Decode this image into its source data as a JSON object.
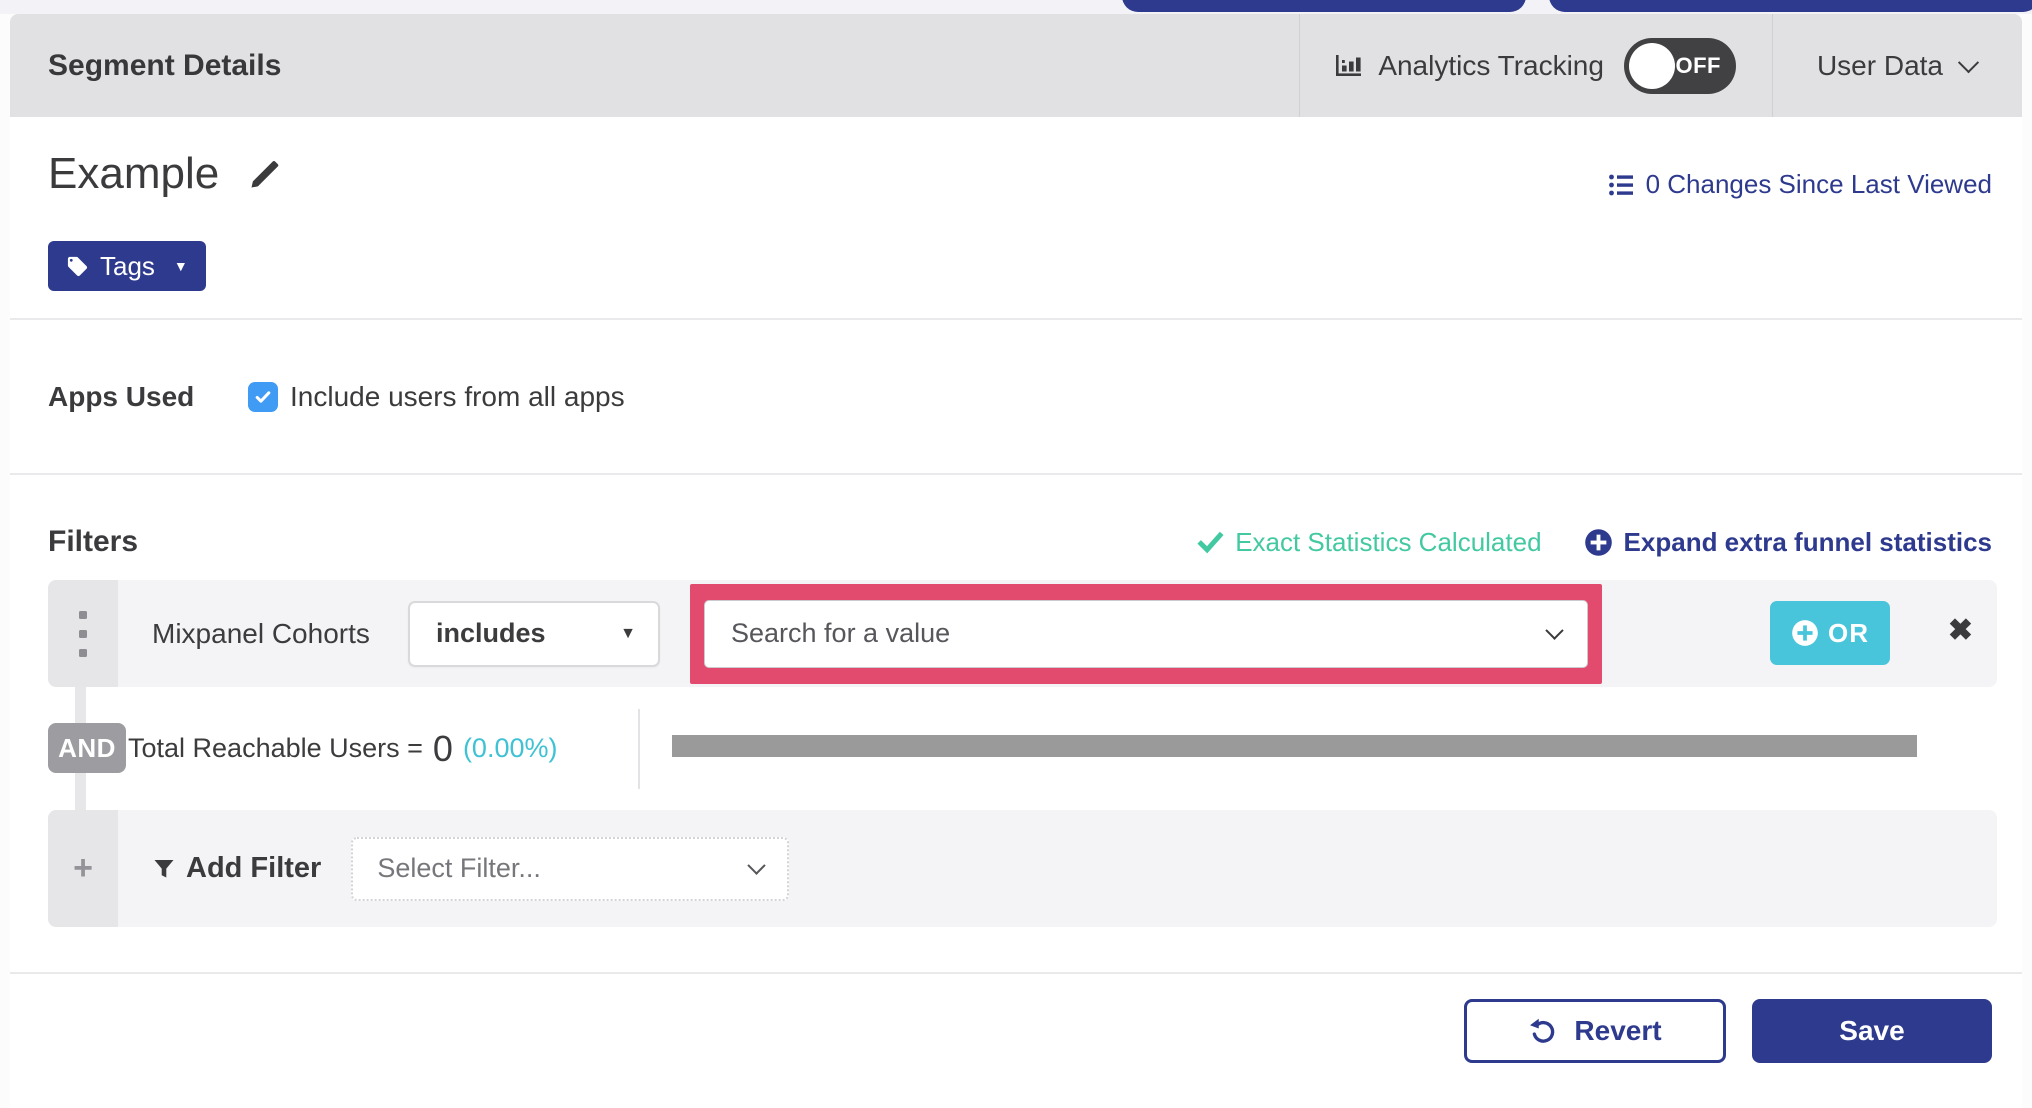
{
  "header": {
    "title": "Segment Details",
    "analytics_label": "Analytics Tracking",
    "toggle_state": "OFF",
    "user_data_label": "User Data"
  },
  "segment": {
    "name": "Example",
    "tags_label": "Tags",
    "changes_link": "0 Changes Since Last Viewed"
  },
  "apps": {
    "label": "Apps Used",
    "checkbox_label": "Include users from all apps",
    "checked": true
  },
  "filters": {
    "title": "Filters",
    "exact_stats_label": "Exact Statistics Calculated",
    "expand_link_label": "Expand extra funnel statistics",
    "row": {
      "field": "Mixpanel Cohorts",
      "operator": "includes",
      "value_placeholder": "Search for a value",
      "or_label": "OR"
    },
    "and_label": "AND",
    "reach_text": "Total Reachable Users =",
    "reach_value": "0",
    "reach_pct": "(0.00%)",
    "add_filter_label": "Add Filter",
    "select_filter_placeholder": "Select Filter..."
  },
  "footer": {
    "revert_label": "Revert",
    "save_label": "Save"
  },
  "icons": {
    "caret_down": "▼",
    "close": "✖",
    "plus": "+"
  },
  "colors": {
    "accent_indigo": "#2e3a8e",
    "accent_teal_or": "#48c5da",
    "status_green": "#43c9a1",
    "stat_cyan": "#3ec2d4",
    "highlight_pink": "#e24a6e",
    "checkbox_blue": "#3f9bf4",
    "header_gray": "#e1e1e4",
    "row_gray": "#f4f4f6",
    "bar_gray": "#9a9a9a"
  }
}
